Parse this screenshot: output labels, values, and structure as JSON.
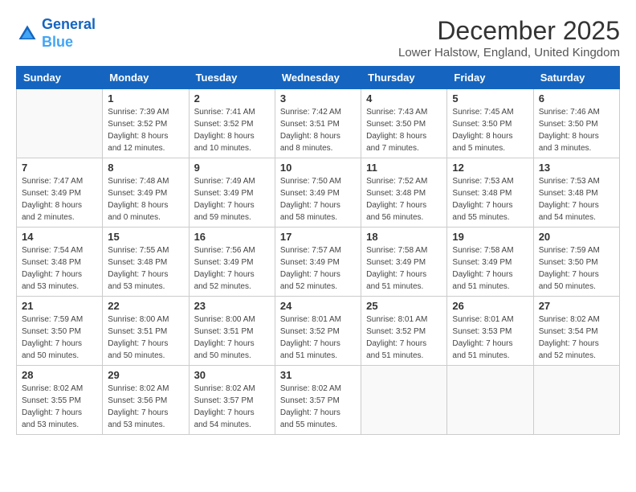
{
  "logo": {
    "line1": "General",
    "line2": "Blue"
  },
  "title": "December 2025",
  "location": "Lower Halstow, England, United Kingdom",
  "weekdays": [
    "Sunday",
    "Monday",
    "Tuesday",
    "Wednesday",
    "Thursday",
    "Friday",
    "Saturday"
  ],
  "weeks": [
    [
      {
        "day": "",
        "sunrise": "",
        "sunset": "",
        "daylight": ""
      },
      {
        "day": "1",
        "sunrise": "Sunrise: 7:39 AM",
        "sunset": "Sunset: 3:52 PM",
        "daylight": "Daylight: 8 hours and 12 minutes."
      },
      {
        "day": "2",
        "sunrise": "Sunrise: 7:41 AM",
        "sunset": "Sunset: 3:52 PM",
        "daylight": "Daylight: 8 hours and 10 minutes."
      },
      {
        "day": "3",
        "sunrise": "Sunrise: 7:42 AM",
        "sunset": "Sunset: 3:51 PM",
        "daylight": "Daylight: 8 hours and 8 minutes."
      },
      {
        "day": "4",
        "sunrise": "Sunrise: 7:43 AM",
        "sunset": "Sunset: 3:50 PM",
        "daylight": "Daylight: 8 hours and 7 minutes."
      },
      {
        "day": "5",
        "sunrise": "Sunrise: 7:45 AM",
        "sunset": "Sunset: 3:50 PM",
        "daylight": "Daylight: 8 hours and 5 minutes."
      },
      {
        "day": "6",
        "sunrise": "Sunrise: 7:46 AM",
        "sunset": "Sunset: 3:50 PM",
        "daylight": "Daylight: 8 hours and 3 minutes."
      }
    ],
    [
      {
        "day": "7",
        "sunrise": "Sunrise: 7:47 AM",
        "sunset": "Sunset: 3:49 PM",
        "daylight": "Daylight: 8 hours and 2 minutes."
      },
      {
        "day": "8",
        "sunrise": "Sunrise: 7:48 AM",
        "sunset": "Sunset: 3:49 PM",
        "daylight": "Daylight: 8 hours and 0 minutes."
      },
      {
        "day": "9",
        "sunrise": "Sunrise: 7:49 AM",
        "sunset": "Sunset: 3:49 PM",
        "daylight": "Daylight: 7 hours and 59 minutes."
      },
      {
        "day": "10",
        "sunrise": "Sunrise: 7:50 AM",
        "sunset": "Sunset: 3:49 PM",
        "daylight": "Daylight: 7 hours and 58 minutes."
      },
      {
        "day": "11",
        "sunrise": "Sunrise: 7:52 AM",
        "sunset": "Sunset: 3:48 PM",
        "daylight": "Daylight: 7 hours and 56 minutes."
      },
      {
        "day": "12",
        "sunrise": "Sunrise: 7:53 AM",
        "sunset": "Sunset: 3:48 PM",
        "daylight": "Daylight: 7 hours and 55 minutes."
      },
      {
        "day": "13",
        "sunrise": "Sunrise: 7:53 AM",
        "sunset": "Sunset: 3:48 PM",
        "daylight": "Daylight: 7 hours and 54 minutes."
      }
    ],
    [
      {
        "day": "14",
        "sunrise": "Sunrise: 7:54 AM",
        "sunset": "Sunset: 3:48 PM",
        "daylight": "Daylight: 7 hours and 53 minutes."
      },
      {
        "day": "15",
        "sunrise": "Sunrise: 7:55 AM",
        "sunset": "Sunset: 3:48 PM",
        "daylight": "Daylight: 7 hours and 53 minutes."
      },
      {
        "day": "16",
        "sunrise": "Sunrise: 7:56 AM",
        "sunset": "Sunset: 3:49 PM",
        "daylight": "Daylight: 7 hours and 52 minutes."
      },
      {
        "day": "17",
        "sunrise": "Sunrise: 7:57 AM",
        "sunset": "Sunset: 3:49 PM",
        "daylight": "Daylight: 7 hours and 52 minutes."
      },
      {
        "day": "18",
        "sunrise": "Sunrise: 7:58 AM",
        "sunset": "Sunset: 3:49 PM",
        "daylight": "Daylight: 7 hours and 51 minutes."
      },
      {
        "day": "19",
        "sunrise": "Sunrise: 7:58 AM",
        "sunset": "Sunset: 3:49 PM",
        "daylight": "Daylight: 7 hours and 51 minutes."
      },
      {
        "day": "20",
        "sunrise": "Sunrise: 7:59 AM",
        "sunset": "Sunset: 3:50 PM",
        "daylight": "Daylight: 7 hours and 50 minutes."
      }
    ],
    [
      {
        "day": "21",
        "sunrise": "Sunrise: 7:59 AM",
        "sunset": "Sunset: 3:50 PM",
        "daylight": "Daylight: 7 hours and 50 minutes."
      },
      {
        "day": "22",
        "sunrise": "Sunrise: 8:00 AM",
        "sunset": "Sunset: 3:51 PM",
        "daylight": "Daylight: 7 hours and 50 minutes."
      },
      {
        "day": "23",
        "sunrise": "Sunrise: 8:00 AM",
        "sunset": "Sunset: 3:51 PM",
        "daylight": "Daylight: 7 hours and 50 minutes."
      },
      {
        "day": "24",
        "sunrise": "Sunrise: 8:01 AM",
        "sunset": "Sunset: 3:52 PM",
        "daylight": "Daylight: 7 hours and 51 minutes."
      },
      {
        "day": "25",
        "sunrise": "Sunrise: 8:01 AM",
        "sunset": "Sunset: 3:52 PM",
        "daylight": "Daylight: 7 hours and 51 minutes."
      },
      {
        "day": "26",
        "sunrise": "Sunrise: 8:01 AM",
        "sunset": "Sunset: 3:53 PM",
        "daylight": "Daylight: 7 hours and 51 minutes."
      },
      {
        "day": "27",
        "sunrise": "Sunrise: 8:02 AM",
        "sunset": "Sunset: 3:54 PM",
        "daylight": "Daylight: 7 hours and 52 minutes."
      }
    ],
    [
      {
        "day": "28",
        "sunrise": "Sunrise: 8:02 AM",
        "sunset": "Sunset: 3:55 PM",
        "daylight": "Daylight: 7 hours and 53 minutes."
      },
      {
        "day": "29",
        "sunrise": "Sunrise: 8:02 AM",
        "sunset": "Sunset: 3:56 PM",
        "daylight": "Daylight: 7 hours and 53 minutes."
      },
      {
        "day": "30",
        "sunrise": "Sunrise: 8:02 AM",
        "sunset": "Sunset: 3:57 PM",
        "daylight": "Daylight: 7 hours and 54 minutes."
      },
      {
        "day": "31",
        "sunrise": "Sunrise: 8:02 AM",
        "sunset": "Sunset: 3:57 PM",
        "daylight": "Daylight: 7 hours and 55 minutes."
      },
      {
        "day": "",
        "sunrise": "",
        "sunset": "",
        "daylight": ""
      },
      {
        "day": "",
        "sunrise": "",
        "sunset": "",
        "daylight": ""
      },
      {
        "day": "",
        "sunrise": "",
        "sunset": "",
        "daylight": ""
      }
    ]
  ]
}
